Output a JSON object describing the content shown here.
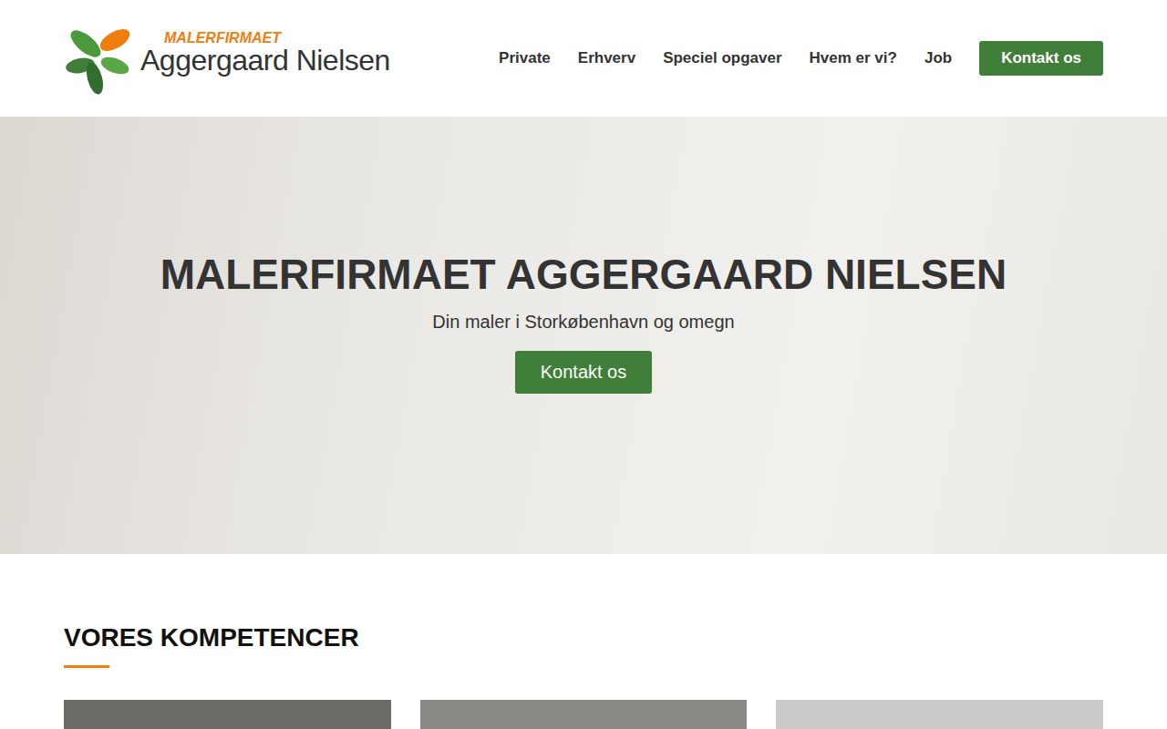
{
  "header": {
    "logo": {
      "top": "MALERFIRMAET",
      "bottom": "Aggergaard Nielsen"
    },
    "nav": [
      {
        "label": "Private"
      },
      {
        "label": "Erhverv"
      },
      {
        "label": "Speciel opgaver"
      },
      {
        "label": "Hvem er vi?"
      },
      {
        "label": "Job"
      }
    ],
    "cta": "Kontakt os"
  },
  "hero": {
    "title": "MALERFIRMAET AGGERGAARD NIELSEN",
    "subtitle": "Din maler i Storkøbenhavn og omegn",
    "button": "Kontakt os"
  },
  "competences": {
    "title": "VORES KOMPETENCER",
    "cards": [
      {
        "kind": "photo",
        "color": "#6b6b66"
      },
      {
        "kind": "photo",
        "color": "#8a8884"
      },
      {
        "kind": "photo",
        "color": "#c9cbcc"
      }
    ]
  }
}
